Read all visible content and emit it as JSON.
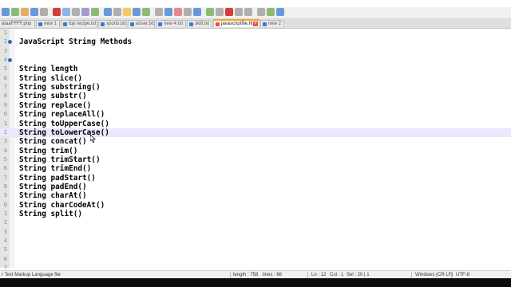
{
  "tabs": [
    {
      "label": "ataaFFFF.php",
      "active": false
    },
    {
      "label": "new 1",
      "active": false
    },
    {
      "label": "top recipe.txt",
      "active": false
    },
    {
      "label": "sports.txt",
      "active": false
    },
    {
      "label": "anser.txt",
      "active": false
    },
    {
      "label": "new 4.txt",
      "active": false
    },
    {
      "label": "skill.txt",
      "active": false
    },
    {
      "label": "javascriptfile.html",
      "active": true
    },
    {
      "label": "new 2",
      "active": false
    }
  ],
  "editor": {
    "current_line": 12,
    "lines": [
      {
        "num": "1",
        "text": "",
        "marker": false
      },
      {
        "num": "2",
        "text": "JavaScript String Methods",
        "marker": true
      },
      {
        "num": "3",
        "text": "",
        "marker": false
      },
      {
        "num": "4",
        "text": "",
        "marker": true
      },
      {
        "num": "5",
        "text": "String length",
        "marker": false
      },
      {
        "num": "6",
        "text": "String slice()",
        "marker": false
      },
      {
        "num": "7",
        "text": "String substring()",
        "marker": false
      },
      {
        "num": "8",
        "text": "String substr()",
        "marker": false
      },
      {
        "num": "9",
        "text": "String replace()",
        "marker": false
      },
      {
        "num": "0",
        "text": "String replaceAll()",
        "marker": false
      },
      {
        "num": "1",
        "text": "String toUpperCase()",
        "marker": false
      },
      {
        "num": "2",
        "text": "String toLowerCase()",
        "marker": false
      },
      {
        "num": "3",
        "text": "String concat()",
        "marker": false
      },
      {
        "num": "4",
        "text": "String trim()",
        "marker": false
      },
      {
        "num": "5",
        "text": "String trimStart()",
        "marker": false
      },
      {
        "num": "6",
        "text": "String trimEnd()",
        "marker": false
      },
      {
        "num": "7",
        "text": "String padStart()",
        "marker": false
      },
      {
        "num": "8",
        "text": "String padEnd()",
        "marker": false
      },
      {
        "num": "9",
        "text": "String charAt()",
        "marker": false
      },
      {
        "num": "0",
        "text": "String charCodeAt()",
        "marker": false
      },
      {
        "num": "1",
        "text": "String split()",
        "marker": false
      },
      {
        "num": "2",
        "text": "",
        "marker": false
      },
      {
        "num": "3",
        "text": "",
        "marker": false
      },
      {
        "num": "4",
        "text": "",
        "marker": false
      },
      {
        "num": "5",
        "text": "",
        "marker": false
      },
      {
        "num": "6",
        "text": "",
        "marker": false
      },
      {
        "num": "7",
        "text": "",
        "marker": false
      }
    ]
  },
  "status": {
    "language": "r Text Markup Language file",
    "length": "length : 758",
    "lines": "lines : 66",
    "ln": "Ln : 12",
    "col": "Col : 1",
    "sel": "Sel : 20 | 1",
    "eol": "Windows (CR LF)",
    "encoding": "UTF-8"
  },
  "colors": {
    "accent_tab": "#f7a21d",
    "marker": "#2e6bc4",
    "current_line": "#e8e8ff"
  }
}
